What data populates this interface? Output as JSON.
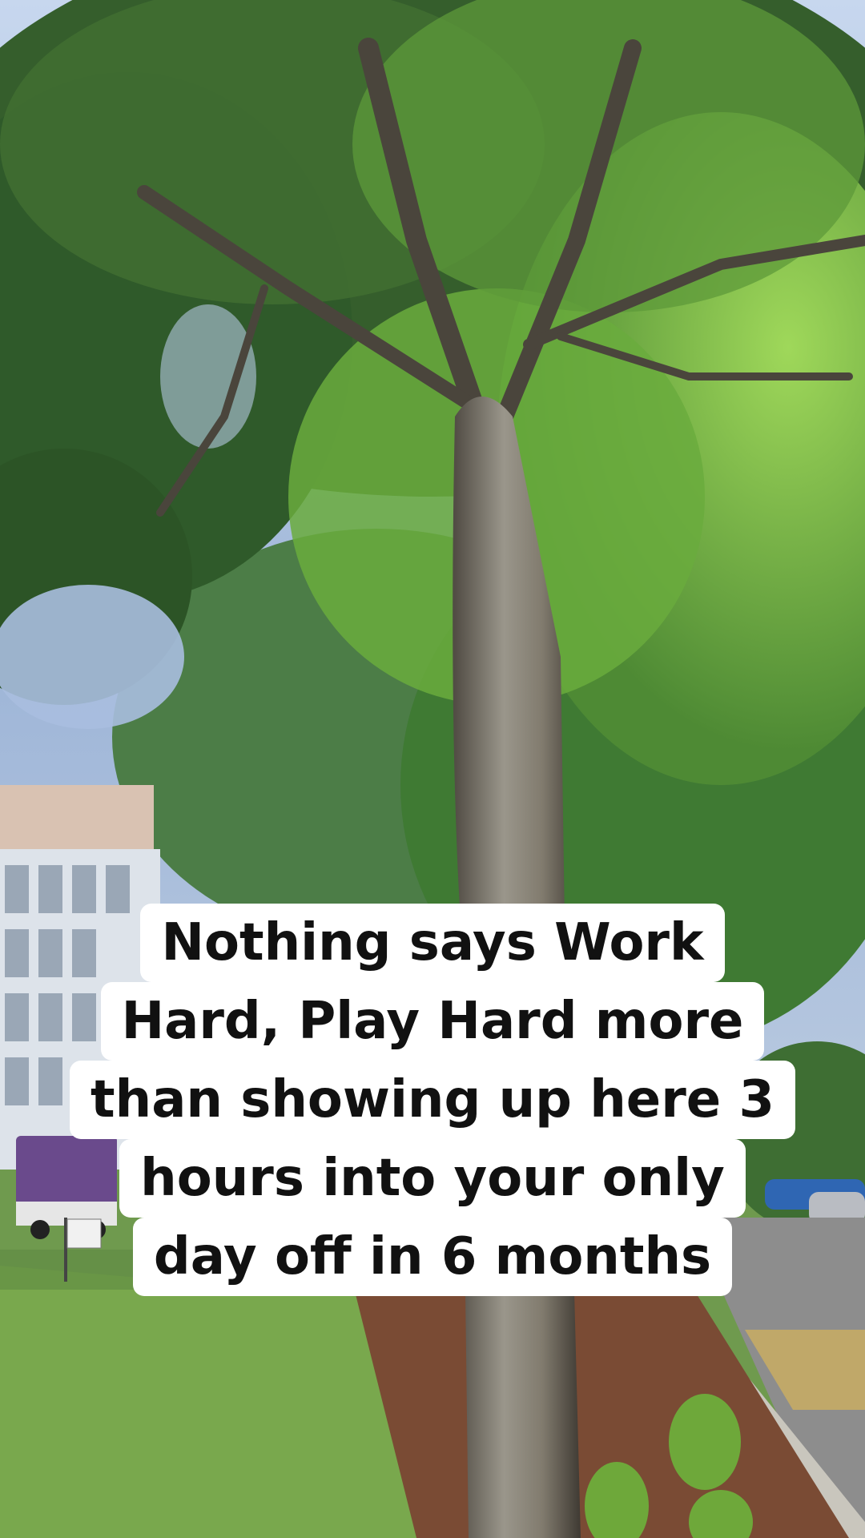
{
  "caption": {
    "lines": [
      "Nothing says Work",
      "Hard, Play Hard more",
      "than showing up here 3",
      "hours into your only",
      "day off in 6 months"
    ]
  },
  "scene": {
    "description_icons": [
      "tree-icon",
      "building-icon",
      "ambulance-icon",
      "sign-icon"
    ],
    "colors": {
      "sky": "#9fb6d8",
      "foliage_dark": "#2f5a2a",
      "foliage_light": "#7fbf3f",
      "trunk": "#7b7466",
      "grass": "#79a84d",
      "mulch": "#7a4b34",
      "building": "#d9c2b2",
      "road": "#8d8d8d"
    }
  }
}
